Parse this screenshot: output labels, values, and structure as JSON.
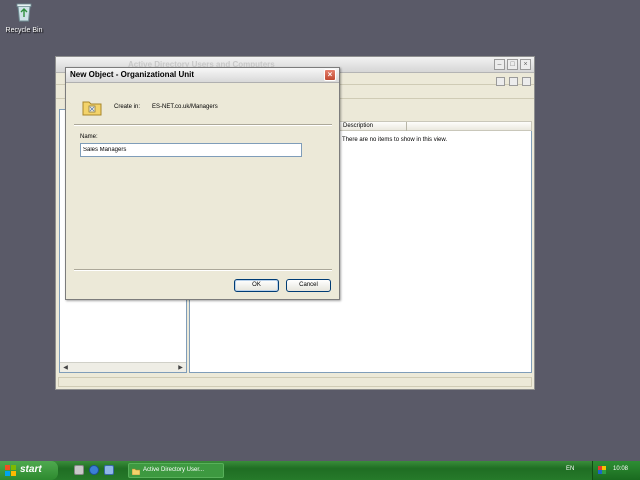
{
  "desktop": {
    "recycle_bin_label": "Recycle Bin"
  },
  "background_window": {
    "title": "Active Directory Users and Computers",
    "column_header": "Description",
    "empty_text": "There are no items to show in this view."
  },
  "dialog": {
    "title": "New Object - Organizational Unit",
    "create_in_label": "Create in:",
    "create_in_value": "ES-NET.co.uk/Managers",
    "name_label": "Name:",
    "name_value": "Sales Managers",
    "ok_label": "OK",
    "cancel_label": "Cancel"
  },
  "taskbar": {
    "start_label": "start",
    "task_item_label": "Active Directory User...",
    "language": "EN",
    "clock": "10:08"
  },
  "colors": {
    "desktop": "#5a5a68",
    "taskbar": "#267a2a",
    "dialog_bg": "#ece9d8",
    "close_button": "#c24a32"
  }
}
